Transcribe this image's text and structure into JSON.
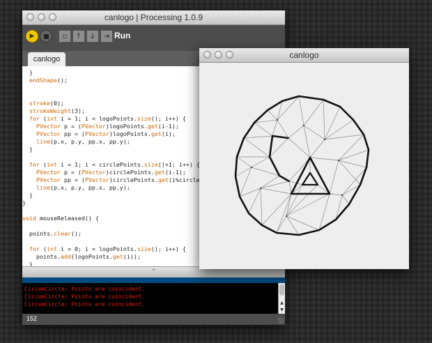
{
  "editor": {
    "title": "canlogo | Processing 1.0.9",
    "toolbar": {
      "run_icon": "play-icon",
      "stop_icon": "stop-icon",
      "new_icon": "new-file-icon",
      "open_icon": "open-icon",
      "save_icon": "save-icon",
      "export_icon": "export-icon",
      "run_label": "Run"
    },
    "tab": "canlogo",
    "code_lines": [
      "  }",
      "  endShape();",
      "",
      "",
      "  stroke(0);",
      "  strokeWeight(3);",
      "  for (int i = 1; i < logoPoints.size(); i++) {",
      "    PVector p = (PVector)logoPoints.get(i-1);",
      "    PVector pp = (PVector)logoPoints.get(i);",
      "    line(p.x, p.y, pp.x, pp.y);",
      "  }",
      "",
      "  for (int i = 1; i < circlePoints.size()+1; i++) {",
      "    PVector p = (PVector)circlePoints.get(i-1);",
      "    PVector pp = (PVector)circlePoints.get(i%circlePoints",
      "    line(p.x, p.y, pp.x, pp.y);",
      "  }",
      "}",
      "",
      "void mouseReleased() {",
      "",
      "  points.clear();",
      "",
      "  for (int i = 0; i < logoPoints.size(); i++) {",
      "    points.add(logoPoints.get(i));",
      "  }"
    ],
    "console_lines": [
      "CircumCircle: Points are coincident.",
      "CircumCircle: Points are coincident.",
      "CircumCircle: Points are coincident."
    ],
    "line_number": "152"
  },
  "sketch": {
    "title": "canlogo"
  },
  "colors": {
    "keyword": "#cc6600",
    "console_error": "#e02010",
    "run_button": "#f3c800"
  }
}
